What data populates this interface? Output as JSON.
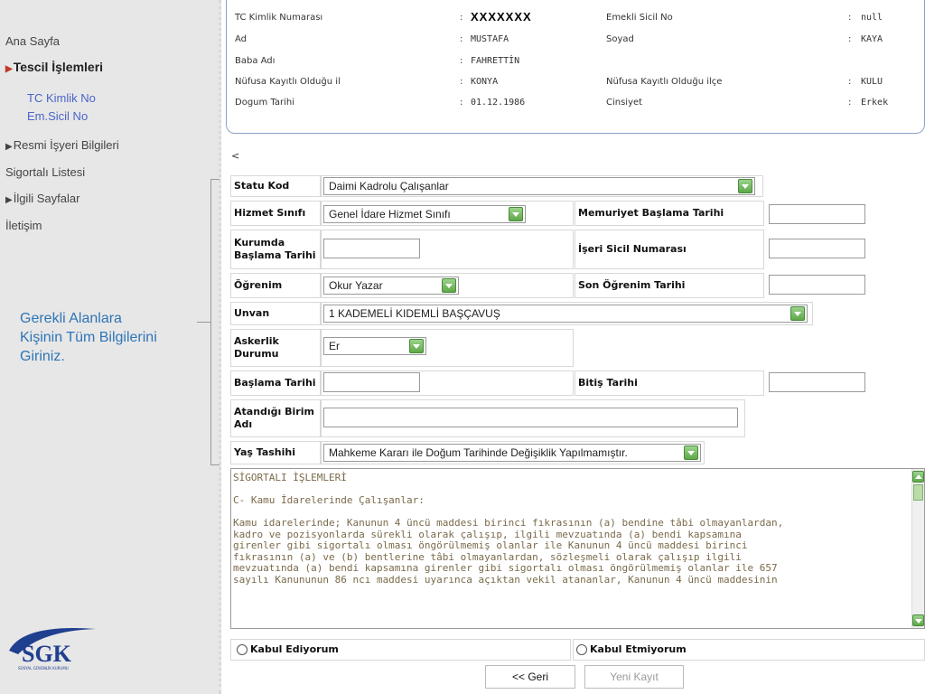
{
  "sidebar": {
    "home": "Ana Sayfa",
    "registration": "Tescil İşlemleri",
    "tc_no": "TC Kimlik No",
    "em_sicil": "Em.Sicil No",
    "official_workplace": "Resmi İşyeri Bilgileri",
    "insured_list": "Sigortalı Listesi",
    "related_pages": "İlgili Sayfalar",
    "contact": "İletişim"
  },
  "annotation": {
    "line1": "Gerekli Alanlara",
    "line2": "Kişinin Tüm Bilgilerini",
    "line3": "Giriniz."
  },
  "logo": {
    "text": "SGK",
    "subtext": "SOSYAL GÜVENLİK KURUMU",
    "color": "#1f3f8f"
  },
  "person": {
    "tc_label": "TC Kimlik Numarası",
    "tc_value": "XXXXXXX",
    "emekli_label": "Emekli Sicil No",
    "emekli_value": "null",
    "ad_label": "Ad",
    "ad_value": "MUSTAFA",
    "soyad_label": "Soyad",
    "soyad_value": "KAYA",
    "baba_label": "Baba Adı",
    "baba_value": "FAHRETTİN",
    "il_label": "Nüfusa Kayıtlı Olduğu il",
    "il_value": "KONYA",
    "ilce_label": "Nüfusa Kayıtlı Olduğu ilçe",
    "ilce_value": "KULU",
    "dogum_label": "Dogum Tarihi",
    "dogum_value": "01.12.1986",
    "cinsiyet_label": "Cinsiyet",
    "cinsiyet_value": "Erkek",
    "colon": ":"
  },
  "back_link": "<",
  "form": {
    "statu_label": "Statu Kod",
    "statu_value": "Daimi Kadrolu Çalışanlar",
    "hizmet_label": "Hizmet Sınıfı",
    "hizmet_value": "Genel İdare Hizmet Sınıfı",
    "memuriyet_label": "Memuriyet Başlama Tarihi",
    "kurumda_label_1": "Kurumda",
    "kurumda_label_2": "Başlama Tarihi",
    "iseri_label": "İşeri Sicil Numarası",
    "ogrenim_label": "Öğrenim",
    "ogrenim_value": "Okur Yazar",
    "son_ogrenim_label": "Son Öğrenim Tarihi",
    "unvan_label": "Unvan",
    "unvan_value": "1 KADEMELİ KIDEMLİ BAŞÇAVUŞ",
    "askerlik_label_1": "Askerlik",
    "askerlik_label_2": "Durumu",
    "askerlik_value": "Er",
    "baslama_label": "Başlama Tarihi",
    "bitis_label": "Bitiş Tarihi",
    "atandigi_label_1": "Atandığı Birim",
    "atandigi_label_2": "Adı",
    "yas_label": "Yaş Tashihi",
    "yas_value": "Mahkeme Kararı ile Doğum Tarihinde Değişiklik Yapılmamıştır."
  },
  "terms": {
    "text": "SİGORTALI İŞLEMLERİ\n\nC- Kamu İdarelerinde Çalışanlar:\n\nKamu idarelerinde; Kanunun 4 üncü maddesi birinci fıkrasının (a) bendine tâbi olmayanlardan,\nkadro ve pozisyonlarda sürekli olarak çalışıp, ilgili mevzuatında (a) bendi kapsamına\ngirenler gibi sigortalı olması öngörülmemiş olanlar ile Kanunun 4 üncü maddesi birinci\nfıkrasının (a) ve (b) bentlerine tâbi olmayanlardan, sözleşmeli olarak çalışıp ilgili\nmevzuatında (a) bendi kapsamına girenler gibi sigortalı olması öngörülmemiş olanlar ile 657\nsayılı Kanununun 86 ncı maddesi uyarınca açıktan vekil atananlar, Kanunun 4 üncü maddesinin"
  },
  "radios": {
    "accept": "Kabul Ediyorum",
    "reject": "Kabul Etmiyorum"
  },
  "buttons": {
    "back": "<< Geri",
    "new_record": "Yeni Kayıt"
  },
  "colors": {
    "accent_blue": "#2e75b6",
    "link_blue": "#4a64c8",
    "green_button": "#5ea848"
  }
}
